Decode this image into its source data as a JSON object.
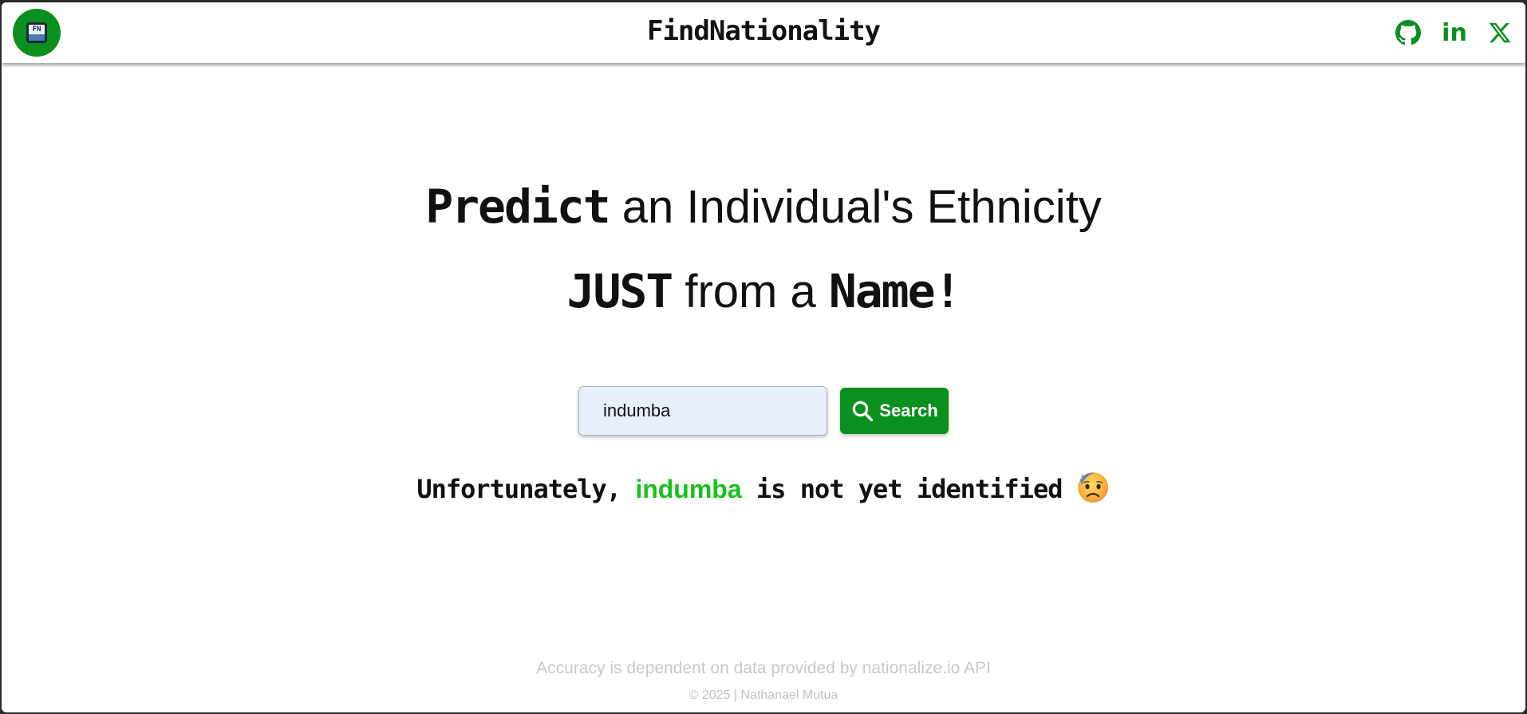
{
  "header": {
    "logo_text": "FN",
    "title": "FindNationality",
    "social": {
      "github_icon": "github-icon",
      "linkedin_label": "in",
      "x_label": "𝕏"
    }
  },
  "hero": {
    "line1_bold": "Predict",
    "line1_rest": " an Individual's Ethnicity",
    "line2_bold1": "JUST",
    "line2_mid": " from a ",
    "line2_bold2": "Name!"
  },
  "search": {
    "value": "indumba",
    "button_label": "Search"
  },
  "result": {
    "prefix": "Unfortunately, ",
    "name": "indumba",
    "suffix": " is not yet identified",
    "emoji": "sweat-worried-face"
  },
  "footer": {
    "note": "Accuracy is dependent on data provided by nationalize.io API",
    "copyright": "© 2025 | Nathanael Mutua"
  },
  "colors": {
    "brand_green": "#0b8f1e",
    "highlight_green": "#18c21a",
    "input_bg": "#e8effc"
  }
}
